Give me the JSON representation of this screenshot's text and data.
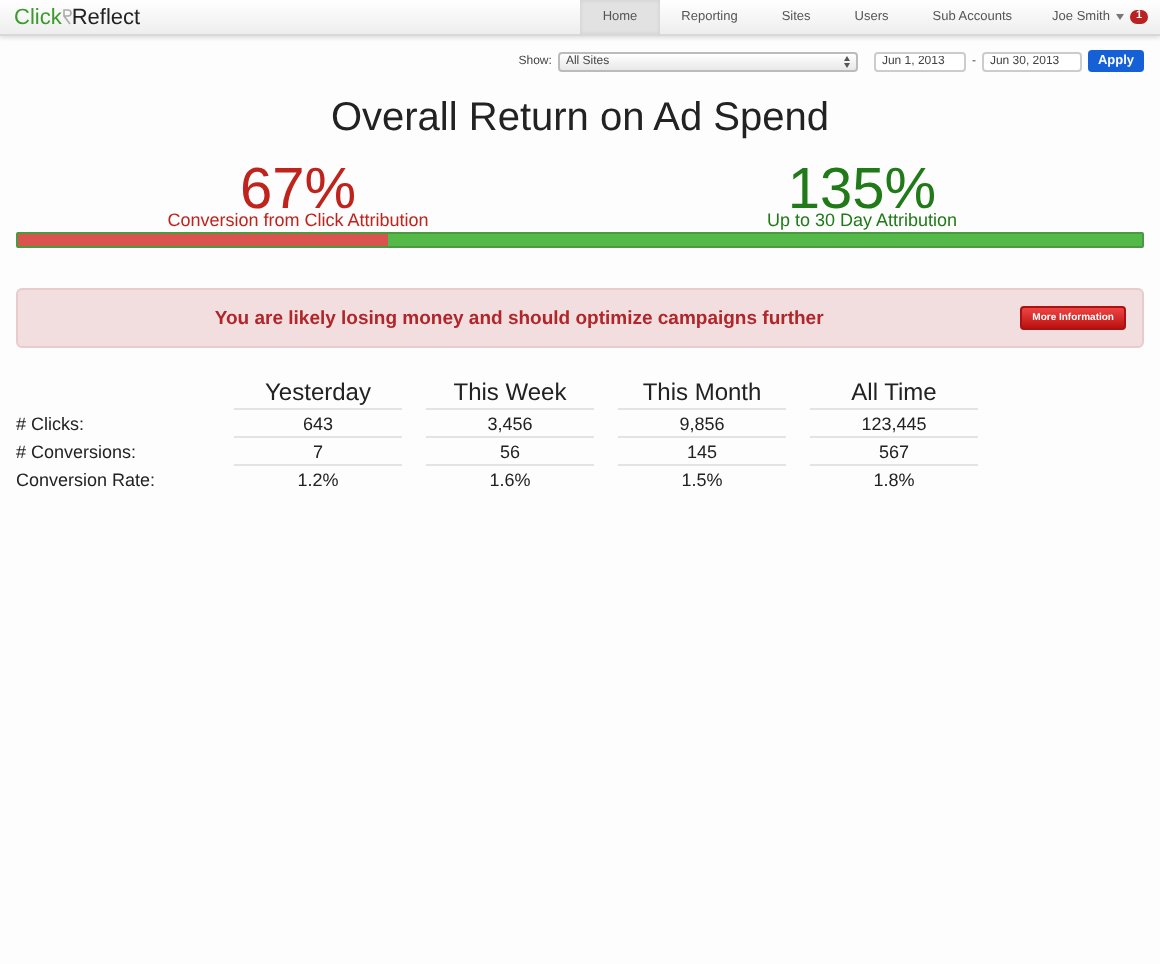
{
  "logo": {
    "first": "Click",
    "second": "Reflect"
  },
  "nav": [
    {
      "label": "Home",
      "selected": true
    },
    {
      "label": "Reporting",
      "selected": false
    },
    {
      "label": "Sites",
      "selected": false
    },
    {
      "label": "Users",
      "selected": false
    },
    {
      "label": "Sub Accounts",
      "selected": false
    }
  ],
  "user": {
    "name": "Joe Smith",
    "badge": "1"
  },
  "filter": {
    "label": "Show:",
    "site": "All Sites",
    "start": "Jun 1, 2013",
    "separator": "-",
    "end": "Jun 30, 2013",
    "apply": "Apply"
  },
  "title": "Overall Return on Ad Spend",
  "metrics": [
    {
      "value": "67%",
      "caption": "Conversion from Click Attribution",
      "color": "#c0231c"
    },
    {
      "value": "135%",
      "caption": "Up to 30 Day Attribution",
      "color": "#1f7a17"
    }
  ],
  "progress": {
    "level": 0.33
  },
  "alert": {
    "message": "You are likely losing money and should optimize campaigns further",
    "button": "More Information"
  },
  "table": {
    "columns": [
      "Yesterday",
      "This Week",
      "This Month",
      "All Time"
    ],
    "rows": [
      {
        "label": "# Clicks:",
        "cells": [
          "643",
          "3,456",
          "9,856",
          "123,445"
        ]
      },
      {
        "label": "# Conversions:",
        "cells": [
          "7",
          "56",
          "145",
          "567"
        ]
      },
      {
        "label": "Conversion Rate:",
        "cells": [
          "1.2%",
          "1.6%",
          "1.5%",
          "1.8%"
        ]
      }
    ]
  }
}
